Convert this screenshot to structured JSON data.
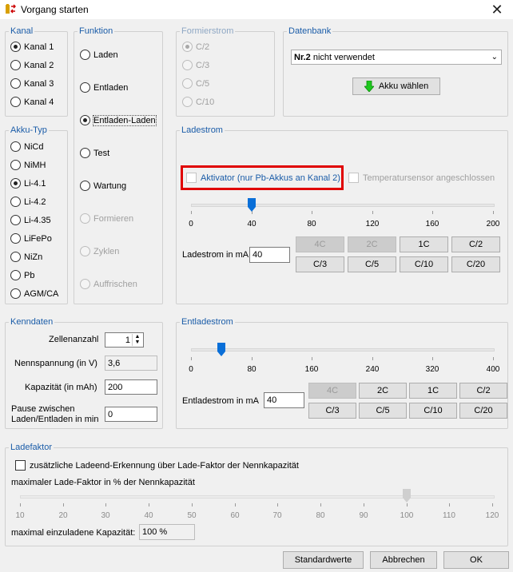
{
  "window": {
    "title": "Vorgang starten",
    "close_glyph": "✕"
  },
  "kanal": {
    "legend": "Kanal",
    "items": [
      "Kanal 1",
      "Kanal 2",
      "Kanal 3",
      "Kanal 4"
    ],
    "selected": "Kanal 1"
  },
  "funktion": {
    "legend": "Funktion",
    "items": [
      "Laden",
      "Entladen",
      "Entladen-Laden",
      "Test",
      "Wartung",
      "Formieren",
      "Zyklen",
      "Auffrischen"
    ],
    "selected": "Entladen-Laden"
  },
  "formierstrom": {
    "legend": "Formierstrom",
    "items": [
      "C/2",
      "C/3",
      "C/5",
      "C/10"
    ],
    "selected": "C/2"
  },
  "datenbank": {
    "legend": "Datenbank",
    "select_bold": "Nr.2",
    "select_rest": " nicht verwendet",
    "choose_button": "Akku wählen"
  },
  "akku_typ": {
    "legend": "Akku-Typ",
    "items": [
      "NiCd",
      "NiMH",
      "Li-4.1",
      "Li-4.2",
      "Li-4.35",
      "LiFePo",
      "NiZn",
      "Pb",
      "AGM/CA"
    ],
    "selected": "Li-4.1"
  },
  "ladestrom": {
    "legend": "Ladestrom",
    "aktivator_label": "Aktivator (nur Pb-Akkus an Kanal 2)",
    "temp_label": "Temperatursensor angeschlossen",
    "ticks": [
      "0",
      "40",
      "80",
      "120",
      "160",
      "200"
    ],
    "slider_value": 40,
    "slider_max": 200,
    "field_label": "Ladestrom in mA",
    "field_value": "40",
    "buttons": [
      "4C",
      "2C",
      "1C",
      "C/2",
      "C/3",
      "C/5",
      "C/10",
      "C/20"
    ]
  },
  "kenndaten": {
    "legend": "Kenndaten",
    "zellen_label": "Zellenanzahl",
    "zellen_value": "1",
    "spannung_label": "Nennspannung (in V)",
    "spannung_value": "3,6",
    "kapazitaet_label": "Kapazität (in mAh)",
    "kapazitaet_value": "200",
    "pause_label_1": "Pause zwischen",
    "pause_label_2": "Laden/Entladen in min",
    "pause_value": "0"
  },
  "entladestrom": {
    "legend": "Entladestrom",
    "ticks": [
      "0",
      "80",
      "160",
      "240",
      "320",
      "400"
    ],
    "slider_value": 40,
    "slider_max": 400,
    "field_label": "Entladestrom in mA",
    "field_value": "40",
    "buttons": [
      "4C",
      "2C",
      "1C",
      "C/2",
      "C/3",
      "C/5",
      "C/10",
      "C/20"
    ]
  },
  "ladefaktor": {
    "legend": "Ladefaktor",
    "checkbox_label": "zusätzliche Ladeend-Erkennung über Lade-Faktor der Nennkapazität",
    "slider_label": "maximaler Lade-Faktor in % der Nennkapazität",
    "ticks": [
      "10",
      "20",
      "30",
      "40",
      "50",
      "60",
      "70",
      "80",
      "90",
      "100",
      "110",
      "120"
    ],
    "slider_value": 100,
    "max_label": "maximal einzuladene Kapazität:",
    "max_value": "100 %"
  },
  "footer": {
    "defaults": "Standardwerte",
    "cancel": "Abbrechen",
    "ok": "OK"
  },
  "colors": {
    "legend": "#1a5ca8",
    "accent": "#0a6fd8",
    "highlight_border": "#e00000"
  }
}
